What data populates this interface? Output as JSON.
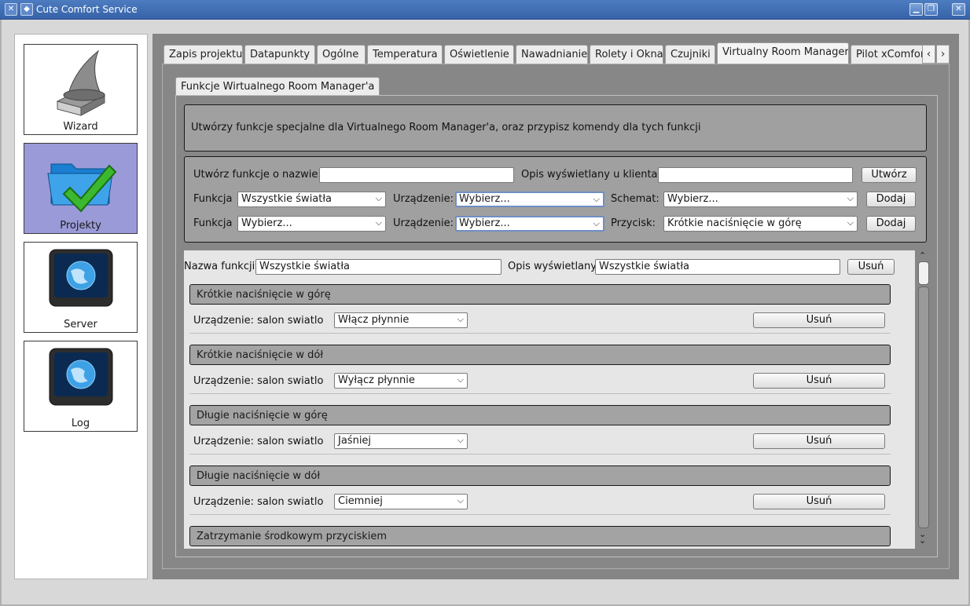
{
  "window": {
    "title": "Cute Comfort Service"
  },
  "sidebar": {
    "items": [
      {
        "label": "Wizard",
        "icon": "wizard-hat-icon"
      },
      {
        "label": "Projekty",
        "icon": "folder-check-icon",
        "active": true
      },
      {
        "label": "Server",
        "icon": "globe-monitor-icon"
      },
      {
        "label": "Log",
        "icon": "globe-monitor-icon"
      }
    ]
  },
  "tabs": [
    "Zapis projektu",
    "Datapunkty",
    "Ogólne",
    "Temperatura",
    "Oświetlenie",
    "Nawadnianie",
    "Rolety i Okna",
    "Czujniki",
    "Virtualny Room Manager",
    "Pilot xComfort"
  ],
  "active_tab": "Virtualny Room Manager",
  "subtab": "Funkcje Wirtualnego Room Manager'a",
  "description": "Utwórzy funkcje specjalne dla Virtualnego Room Manager'a, oraz przypisz komendy dla tych funkcji",
  "create": {
    "name_label": "Utwórz funkcje o nazwie:",
    "name_value": "",
    "desc_label": "Opis wyświetlany u klienta:",
    "desc_value": "",
    "create_btn": "Utwórz",
    "row1": {
      "func_label": "Funkcja",
      "func_value": "Wszystkie światła",
      "dev_label": "Urządzenie:",
      "dev_value": "Wybierz...",
      "scheme_label": "Schemat:",
      "scheme_value": "Wybierz...",
      "add_btn": "Dodaj"
    },
    "row2": {
      "func_label": "Funkcja",
      "func_value": "Wybierz...",
      "dev_label": "Urządzenie:",
      "dev_value": "Wybierz...",
      "button_label": "Przycisk:",
      "button_value": "Krótkie naciśnięcie w górę",
      "add_btn": "Dodaj"
    }
  },
  "function": {
    "name_label": "Nazwa funkcji",
    "name_value": "Wszystkie światła",
    "desc_label": "Opis wyświetlany",
    "desc_value": "Wszystkie światła",
    "delete_btn": "Usuń",
    "sections": [
      {
        "header": "Krótkie naciśnięcie w górę",
        "device": "Urządzenie: salon swiatlo",
        "action": "Włącz płynnie",
        "delete": "Usuń"
      },
      {
        "header": "Krótkie naciśnięcie w dół",
        "device": "Urządzenie: salon swiatlo",
        "action": "Wyłącz płynnie",
        "delete": "Usuń"
      },
      {
        "header": "Długie naciśnięcie w górę",
        "device": "Urządzenie: salon swiatlo",
        "action": "Jaśniej",
        "delete": "Usuń"
      },
      {
        "header": "Długie naciśnięcie w dół",
        "device": "Urządzenie: salon swiatlo",
        "action": "Ciemniej",
        "delete": "Usuń"
      },
      {
        "header": "Zatrzymanie środkowym przyciskiem"
      }
    ]
  }
}
